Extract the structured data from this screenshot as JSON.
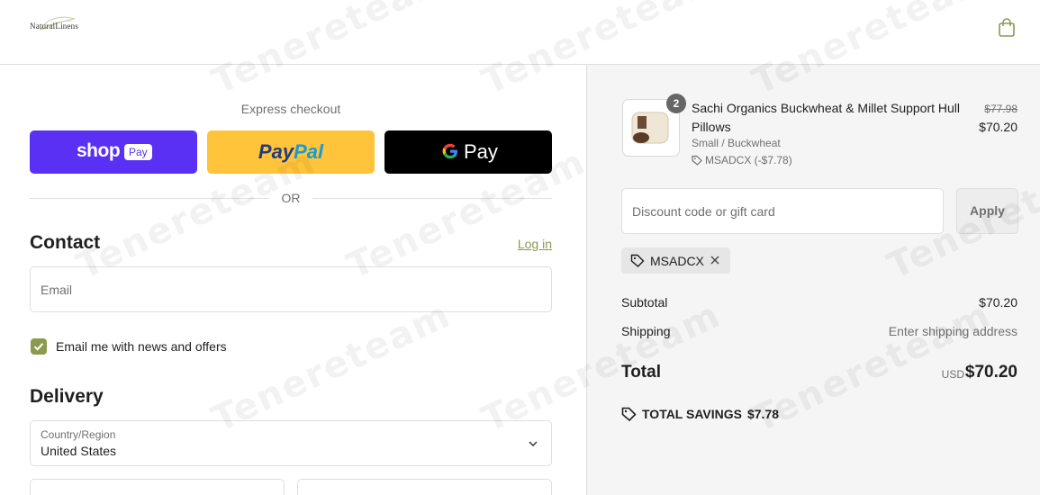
{
  "header": {
    "logo_text": "NaturalLinens",
    "cart_icon": "shopping-bag-icon"
  },
  "colors": {
    "accent": "#8a9a4e",
    "shop_pay": "#5a31f4",
    "paypal": "#ffc439",
    "gpay": "#000000",
    "summary_bg": "#f5f5f5"
  },
  "express": {
    "title": "Express checkout",
    "shop_label": "shop",
    "shop_badge": "Pay",
    "paypal_label_1": "Pay",
    "paypal_label_2": "Pal",
    "gpay_label": "Pay",
    "or": "OR"
  },
  "contact": {
    "title": "Contact",
    "login": "Log in",
    "email_placeholder": "Email",
    "newsletter_label": "Email me with news and offers",
    "newsletter_checked": true
  },
  "delivery": {
    "title": "Delivery",
    "country_label": "Country/Region",
    "country_value": "United States"
  },
  "order": {
    "item": {
      "quantity": "2",
      "name": "Sachi Organics Buckwheat & Millet Support Hull Pillows",
      "variant": "Small / Buckwheat",
      "discount": "MSADCX (-$7.78)",
      "price_original": "$77.98",
      "price_final": "$70.20"
    },
    "discount_placeholder": "Discount code or gift card",
    "apply_label": "Apply",
    "applied_code": "MSADCX",
    "subtotal_label": "Subtotal",
    "subtotal_value": "$70.20",
    "shipping_label": "Shipping",
    "shipping_value": "Enter shipping address",
    "total_label": "Total",
    "currency": "USD",
    "total_value": "$70.20",
    "savings_label": "TOTAL SAVINGS",
    "savings_value": "$7.78"
  },
  "watermark": "Tenereteam"
}
